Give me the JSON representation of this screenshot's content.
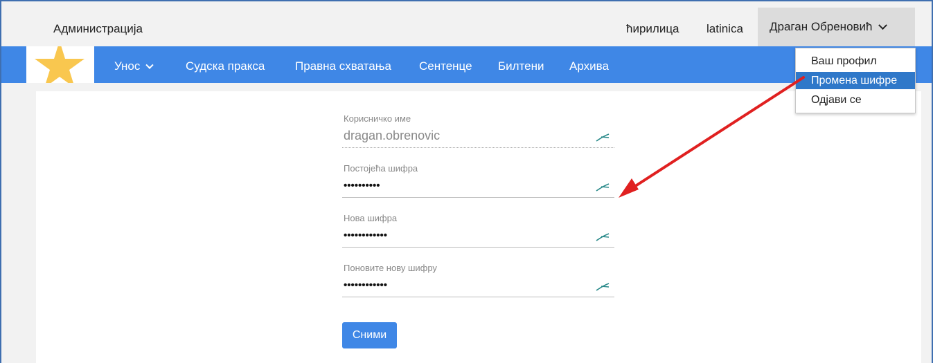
{
  "topbar": {
    "admin": "Администрација",
    "lang_cyrillic": "ћирилица",
    "lang_latin": "latinica",
    "user_name": "Драган Обреновић"
  },
  "nav": {
    "items": [
      {
        "label": "Унос"
      },
      {
        "label": "Судска пракса"
      },
      {
        "label": "Правна схватања"
      },
      {
        "label": "Сентенце"
      },
      {
        "label": "Билтени"
      },
      {
        "label": "Архива"
      }
    ]
  },
  "dropdown": {
    "items": [
      {
        "label": "Ваш профил"
      },
      {
        "label": "Промена шифре"
      },
      {
        "label": "Одјави се"
      }
    ]
  },
  "form": {
    "username_label": "Корисничко име",
    "username_value": "dragan.obrenovic",
    "current_label": "Постојећа шифра",
    "current_value": "••••••••••",
    "new_label": "Нова шифра",
    "new_value": "••••••••••••",
    "repeat_label": "Поновите нову шифру",
    "repeat_value": "••••••••••••",
    "save_label": "Сними"
  },
  "colors": {
    "nav_bg": "#3f87e6",
    "dropdown_active": "#2f78c9",
    "arrow": "#e02020",
    "logo_star": "#f9c74f"
  },
  "icons": {
    "field_icon": "reveal-icon",
    "logo": "star-logo"
  }
}
